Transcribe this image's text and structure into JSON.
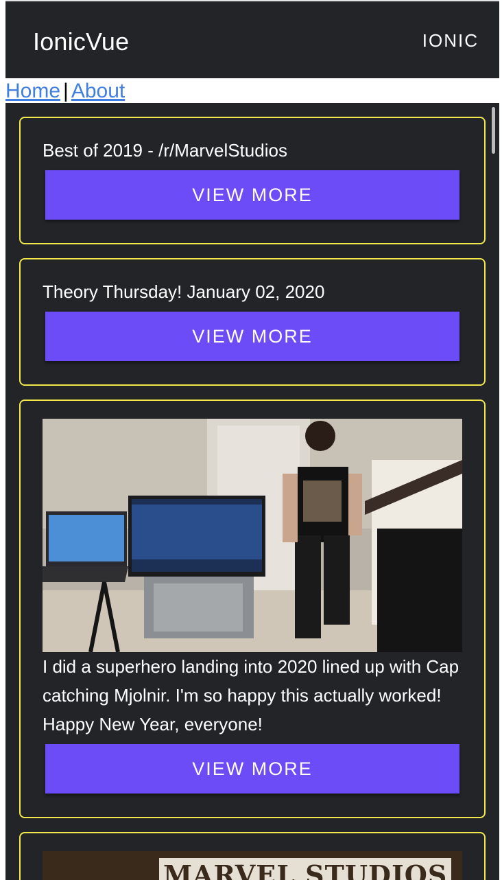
{
  "app": {
    "title": "IonicVue",
    "action_label": "IONIC"
  },
  "nav": {
    "home": "Home",
    "separator": "|",
    "about": "About"
  },
  "posts": [
    {
      "title": "Best of 2019 - /r/MarvelStudios",
      "button_label": "VIEW MORE"
    },
    {
      "title": "Theory Thursday! January 02, 2020",
      "button_label": "VIEW MORE"
    },
    {
      "title": "I did a superhero landing into 2020 lined up with Cap catching Mjolnir. I'm so happy this actually worked! Happy New Year, everyone!",
      "button_label": "VIEW MORE"
    }
  ],
  "partial_card_image_text": "MARVEL STUDIOS",
  "colors": {
    "toolbar_bg": "#222428",
    "card_border": "#f2e84a",
    "button_bg": "#6b4cf6",
    "link": "#3f7fe0"
  }
}
